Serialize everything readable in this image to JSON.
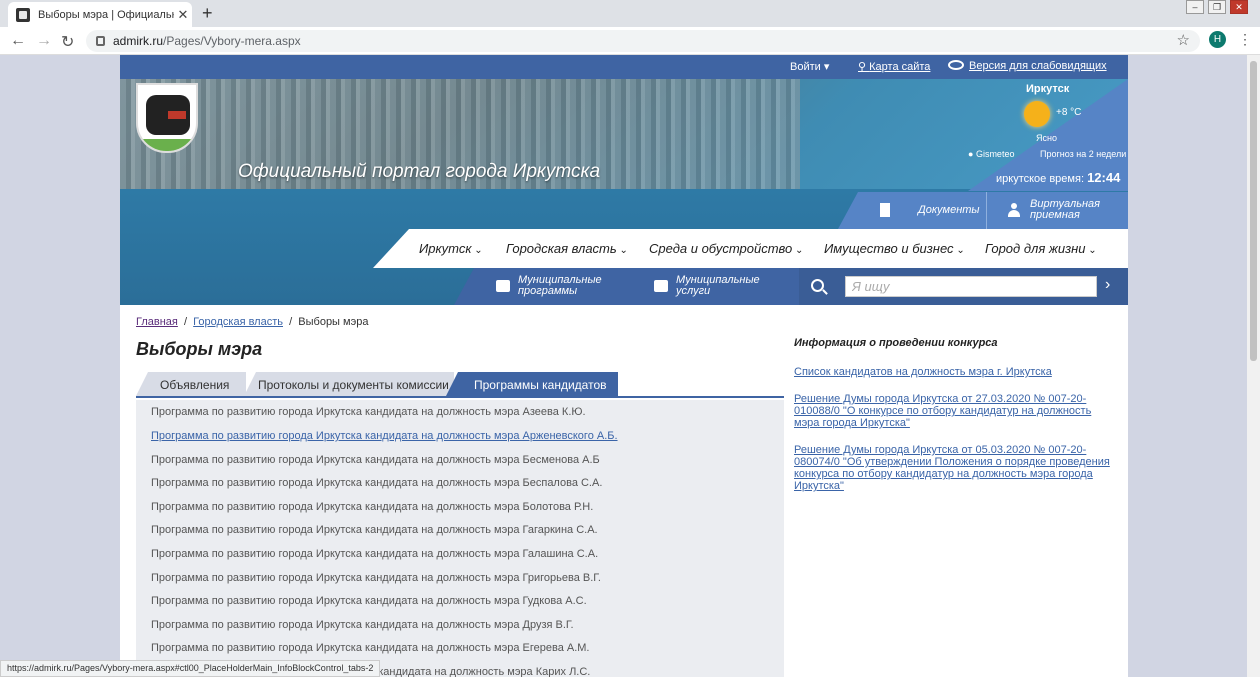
{
  "browser": {
    "tab_title": "Выборы мэра | Официальный пор",
    "tab_close": "✕",
    "new_tab": "+",
    "url_host": "admirk.ru",
    "url_path": "/Pages/Vybory-mera.aspx",
    "avatar_letter": "H",
    "status_url": "https://admirk.ru/Pages/Vybory-mera.aspx#ctl00_PlaceHolderMain_InfoBlockControl_tabs-2"
  },
  "topbar": {
    "login": "Войти ▾",
    "sitemap": "Карта сайта",
    "low_vision": "Версия для слабовидящих"
  },
  "hero": {
    "title": "Официальный портал города Иркутска"
  },
  "weather": {
    "city": "Иркутск",
    "temp": "+8 °C",
    "condition": "Ясно",
    "provider": "Gismeteo",
    "forecast": "Прогноз на 2 недели",
    "time_label": "иркутское время:",
    "time": "12:44"
  },
  "docbar": {
    "documents": "Документы",
    "virtual_reception": "Виртуальная приемная"
  },
  "mainnav": [
    "Иркутск",
    "Городская власть",
    "Среда и обустройство",
    "Имущество и бизнес",
    "Город для жизни"
  ],
  "subnav": {
    "programs": "Муниципальные программы",
    "services": "Муниципальные услуги"
  },
  "search": {
    "placeholder": "Я ищу"
  },
  "breadcrumb": {
    "home": "Главная",
    "section": "Городская власть",
    "current": "Выборы мэра"
  },
  "page_title": "Выборы мэра",
  "tabs": [
    "Объявления",
    "Протоколы и документы комиссии",
    "Программы кандидатов"
  ],
  "programs": [
    "Программа по развитию города Иркутска кандидата на должность мэра Азеева К.Ю.",
    "Программа по развитию города Иркутска кандидата на должность мэра Арженевского А.Б.",
    "Программа по развитию города Иркутска кандидата на должность мэра Бесменова А.Б",
    "Программа по развитию города Иркутска кандидата на должность мэра Беспалова С.А.",
    "Программа по развитию города Иркутска кандидата на должность мэра Болотова Р.Н.",
    "Программа по развитию города Иркутска кандидата на должность мэра Гагаркина С.А.",
    "Программа по развитию города Иркутска кандидата на должность мэра Галашина С.А.",
    "Программа по развитию города Иркутска кандидата на должность мэра Григорьева В.Г.",
    "Программа по развитию города Иркутска кандидата на должность мэра Гудкова А.С.",
    "Программа по развитию города Иркутска кандидата на должность мэра Друзя В.Г.",
    "Программа по развитию города Иркутска кандидата на должность мэра Егерева А.М.",
    "ка кандидата на должность мэра Карих Л.С."
  ],
  "info": {
    "heading": "Информация о проведении конкурса",
    "links": [
      "Список кандидатов на должность мэра г. Иркутска",
      "Решение Думы города Иркутска от 27.03.2020 № 007-20-010088/0 \"О конкурсе по отбору кандидатур на должность мэра города Иркутска\"",
      "Решение Думы города Иркутска от 05.03.2020 № 007-20-080074/0 \"Об утверждении Положения о порядке проведения конкурса по отбору кандидатур на должность мэра города Иркутска\""
    ]
  }
}
